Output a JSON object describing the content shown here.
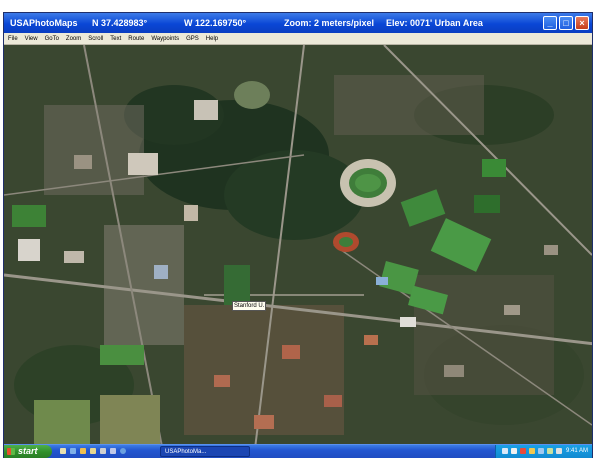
{
  "window": {
    "app_title": "USAPhotoMaps",
    "latitude": "N 37.428983°",
    "longitude": "W 122.169750°",
    "zoom": "Zoom: 2 meters/pixel",
    "elevation": "Elev: 0071' Urban Area",
    "controls": {
      "minimize": "_",
      "maximize": "□",
      "close": "×"
    }
  },
  "menu": [
    "File",
    "View",
    "GoTo",
    "Zoom",
    "Scroll",
    "Text",
    "Route",
    "Waypoints",
    "GPS",
    "Help"
  ],
  "map": {
    "place_label": "Stanford U."
  },
  "taskbar": {
    "start_label": "start",
    "task_button": "USAPhotoMa...",
    "clock": "9:41 AM",
    "quick_launch_icons": [
      "desktop-icon",
      "browser-icon",
      "media-icon",
      "folder-icon",
      "app-icon",
      "app-icon",
      "globe-icon"
    ],
    "tray_icons": [
      "network-icon",
      "volume-icon",
      "security-icon",
      "update-icon",
      "app-icon",
      "app-icon",
      "app-icon"
    ]
  },
  "colors": {
    "titlebar": "#0a47d6",
    "start_button": "#2f8f2a",
    "taskbar": "#2356d0",
    "tray": "#118ad1"
  }
}
